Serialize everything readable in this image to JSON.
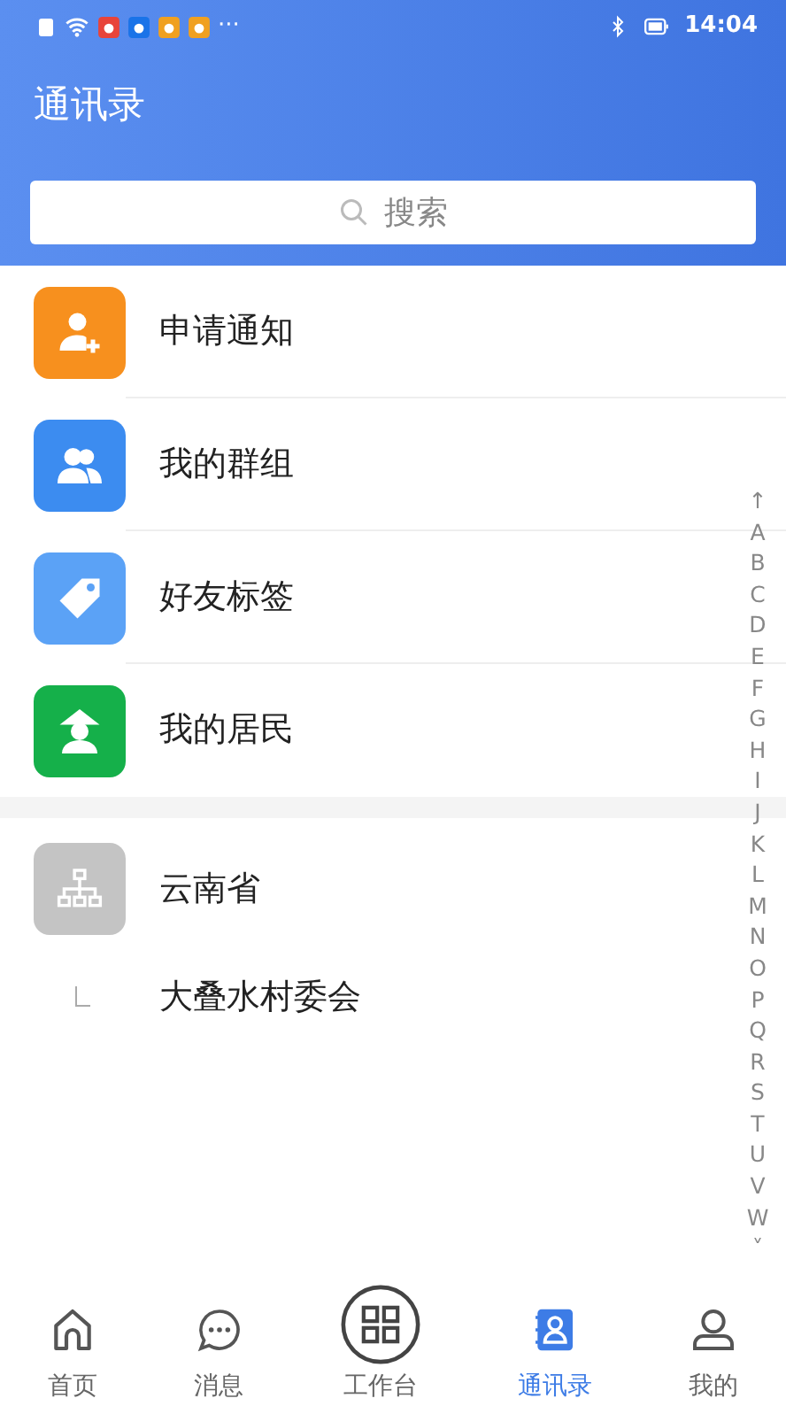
{
  "status_bar": {
    "more": "···",
    "time": "14:04",
    "notifications": [
      {
        "color": "#e8443a"
      },
      {
        "color": "#1a73e8"
      },
      {
        "color": "#f0a020"
      },
      {
        "color": "#f0a020"
      }
    ]
  },
  "header": {
    "title": "通讯录"
  },
  "search": {
    "placeholder": "搜索"
  },
  "menu": [
    {
      "label": "申请通知",
      "kind": "apply",
      "color": "#f7901e"
    },
    {
      "label": "我的群组",
      "kind": "group",
      "color": "#3c8cf0"
    },
    {
      "label": "好友标签",
      "kind": "tag",
      "color": "#5ba2f6"
    },
    {
      "label": "我的居民",
      "kind": "resident",
      "color": "#15b04a"
    }
  ],
  "organization": {
    "label": "云南省",
    "children": [
      {
        "label": "大叠水村委会"
      }
    ]
  },
  "index_bar": [
    "↑",
    "A",
    "B",
    "C",
    "D",
    "E",
    "F",
    "G",
    "H",
    "I",
    "J",
    "K",
    "L",
    "M",
    "N",
    "O",
    "P",
    "Q",
    "R",
    "S",
    "T",
    "U",
    "V",
    "W",
    "˅"
  ],
  "tabs": [
    {
      "label": "首页",
      "kind": "home",
      "selected": false
    },
    {
      "label": "消息",
      "kind": "message",
      "selected": false
    },
    {
      "label": "工作台",
      "kind": "workbench",
      "selected": false
    },
    {
      "label": "通讯录",
      "kind": "contacts",
      "selected": true
    },
    {
      "label": "我的",
      "kind": "profile",
      "selected": false
    }
  ]
}
